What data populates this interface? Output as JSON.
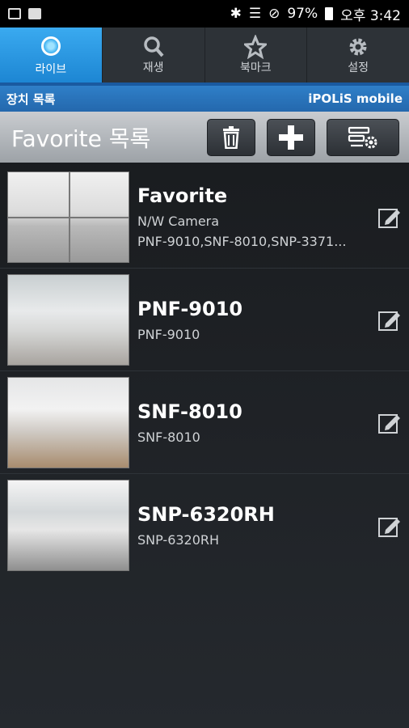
{
  "status_bar": {
    "battery": "97%",
    "time": "오후 3:42"
  },
  "tabs": [
    {
      "label": "라이브",
      "icon": "live-icon",
      "active": true
    },
    {
      "label": "재생",
      "icon": "search-icon",
      "active": false
    },
    {
      "label": "북마크",
      "icon": "star-icon",
      "active": false
    },
    {
      "label": "설정",
      "icon": "gear-icon",
      "active": false
    }
  ],
  "sub_header": {
    "left": "장치 목록",
    "right": "iPOLiS mobile"
  },
  "list_header": {
    "title": "Favorite 목록"
  },
  "devices": [
    {
      "name": "Favorite",
      "line1": "N/W Camera",
      "line2": "PNF-9010,SNF-8010,SNP-3371..."
    },
    {
      "name": "PNF-9010",
      "line1": "PNF-9010"
    },
    {
      "name": "SNF-8010",
      "line1": "SNF-8010"
    },
    {
      "name": "SNP-6320RH",
      "line1": "SNP-6320RH"
    }
  ],
  "colors": {
    "active_tab": "#2a97e3",
    "sub_header": "#2a72b8"
  }
}
